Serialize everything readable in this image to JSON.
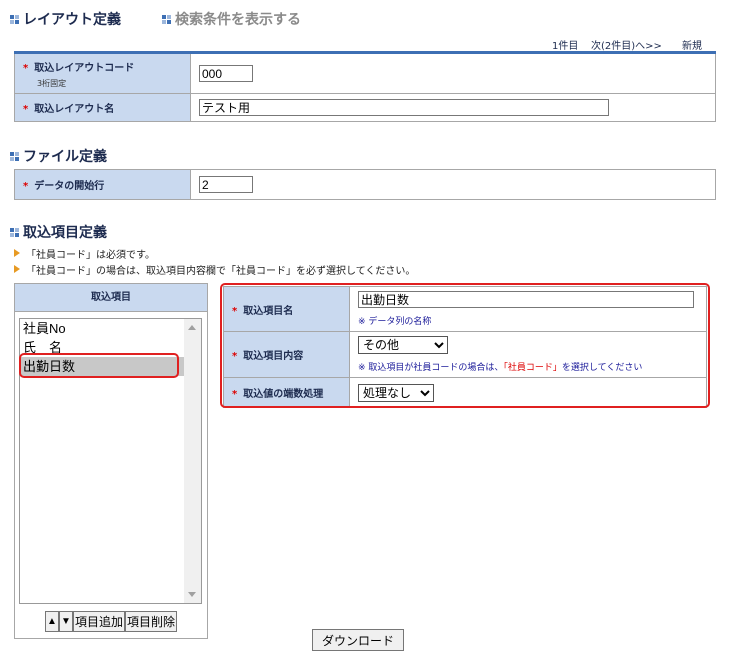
{
  "header": {
    "layout_title": "レイアウト定義",
    "search_link": "検索条件を表示する"
  },
  "pagination": {
    "current": "1件目",
    "next": "次(2件目)へ>>",
    "new": "新規"
  },
  "layout_form": {
    "code_label": "取込レイアウトコード",
    "code_note": "3桁固定",
    "code_value": "000",
    "name_label": "取込レイアウト名",
    "name_value": "テスト用"
  },
  "file_section": {
    "title": "ファイル定義",
    "start_row_label": "データの開始行",
    "start_row_value": "2"
  },
  "items_section": {
    "title": "取込項目定義",
    "notes": [
      "「社員コード」は必須です。",
      "「社員コード」の場合は、取込項目内容欄で「社員コード」を必ず選択してください。"
    ],
    "list_header": "取込項目",
    "list_items": [
      "社員No",
      "氏　名",
      "出勤日数"
    ],
    "selected_index": 2,
    "btn_up": "▲",
    "btn_down": "▼",
    "btn_add": "項目追加",
    "btn_delete": "項目削除"
  },
  "detail": {
    "item_name_label": "取込項目名",
    "item_name_value": "出勤日数",
    "item_name_hint": "※ データ列の名称",
    "content_label": "取込項目内容",
    "content_selected": "その他",
    "content_hint_a": "※ 取込項目が社員コードの場合は、",
    "content_hint_b": "「社員コード」",
    "content_hint_c": "を選択してください",
    "rounding_label": "取込値の端数処理",
    "rounding_selected": "処理なし"
  },
  "footer": {
    "download": "ダウンロード"
  },
  "colors": {
    "label_bg": "#c9d9ef",
    "required": "#dd0000",
    "highlight": "#e02020"
  },
  "required_mark": "*"
}
